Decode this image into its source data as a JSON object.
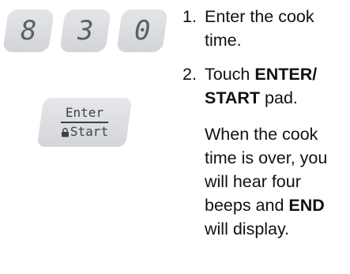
{
  "keypad": {
    "digits": [
      "8",
      "3",
      "0"
    ],
    "enter_pad": {
      "top_label": "Enter",
      "bottom_label": "Start",
      "icon": "lock-icon"
    }
  },
  "steps": [
    {
      "number": "1.",
      "text": "Enter the cook time."
    },
    {
      "number": "2.",
      "prefix": "Touch ",
      "bold1": "ENTER/",
      "bold2": "START",
      "suffix": " pad."
    }
  ],
  "note": {
    "before": "When the cook time is over, you will hear four beeps and ",
    "bold": "END",
    "after": " will display."
  }
}
